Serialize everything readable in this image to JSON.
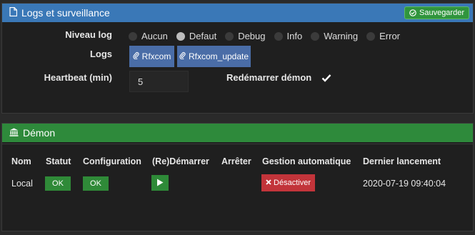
{
  "logs_panel": {
    "title": "Logs et surveillance",
    "save_label": "Sauvegarder",
    "niveau_log_label": "Niveau log",
    "log_levels": [
      "Aucun",
      "Defaut",
      "Debug",
      "Info",
      "Warning",
      "Error"
    ],
    "selected_level": "Defaut",
    "logs_label": "Logs",
    "log_buttons": [
      "Rfxcom",
      "Rfxcom_update"
    ],
    "heartbeat_label": "Heartbeat (min)",
    "heartbeat_value": "5",
    "restart_label": "Redémarrer démon",
    "restart_checked": true
  },
  "demon_panel": {
    "title": "Démon",
    "columns": [
      "Nom",
      "Statut",
      "Configuration",
      "(Re)Démarrer",
      "Arrêter",
      "Gestion automatique",
      "Dernier lancement"
    ],
    "row": {
      "nom": "Local",
      "statut": "OK",
      "configuration": "OK",
      "gestion_label": "Désactiver",
      "dernier_lancement": "2020-07-19 09:40:04"
    }
  },
  "colors": {
    "logs_header": "#3a78b7",
    "demon_header": "#2e8a3b",
    "ok_green": "#2f8a38",
    "danger_red": "#c2343a",
    "log_button_blue": "#4a6da7"
  },
  "icons": {
    "logs_title": "file-icon",
    "save": "check-circle-icon",
    "log_button": "paperclip-icon",
    "demon_title": "bank-icon",
    "start": "play-icon",
    "deactivate": "times-icon"
  }
}
